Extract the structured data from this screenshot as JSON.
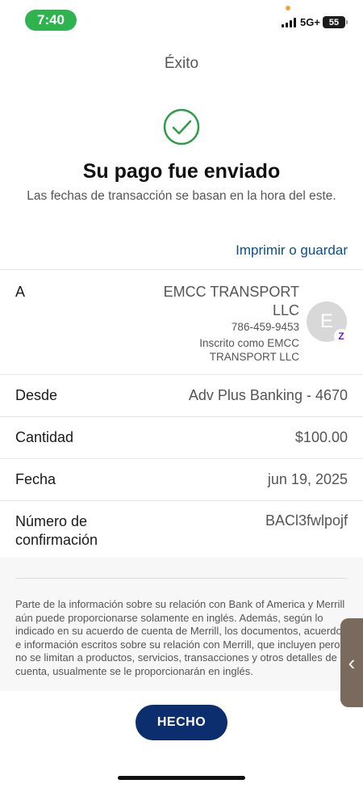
{
  "status_bar": {
    "time": "7:40",
    "network": "5G+",
    "battery": "55"
  },
  "page_title": "Éxito",
  "headline": "Su pago fue enviado",
  "subhead": "Las fechas de transacción se basan en la hora del este.",
  "print_link": "Imprimir o guardar",
  "details": {
    "to": {
      "label": "A",
      "name": "EMCC TRANSPORT LLC",
      "phone": "786-459-9453",
      "registered": "Inscrito como EMCC TRANSPORT LLC",
      "avatar_letter": "E",
      "badge": "Z"
    },
    "from": {
      "label": "Desde",
      "value": "Adv Plus Banking - 4670"
    },
    "amount": {
      "label": "Cantidad",
      "value": "$100.00"
    },
    "date": {
      "label": "Fecha",
      "value": "jun 19, 2025"
    },
    "confirmation": {
      "label": "Número de confirmación",
      "value": "BACl3fwlpojf"
    }
  },
  "disclaimer": "Parte de la información sobre su relación con Bank of America y Merrill aún puede proporcionarse solamente en inglés. Además, según lo indicado en su acuerdo de cuenta de Merrill, los documentos, acuerdos e información escritos sobre su relación con Merrill, que incluyen pero no se limitan a productos, servicios, transacciones y otros detalles de cuenta, usualmente se le proporcionarán en inglés.",
  "done_button": "HECHO",
  "side_handle": "‹",
  "colors": {
    "accent": "#0c2d6e",
    "link": "#0a4d91",
    "success": "#2e9d4a",
    "time_pill": "#2fb34f"
  },
  "icons": {
    "check": "check-circle-icon",
    "signal": "signal-bars-icon",
    "battery": "battery-icon"
  }
}
